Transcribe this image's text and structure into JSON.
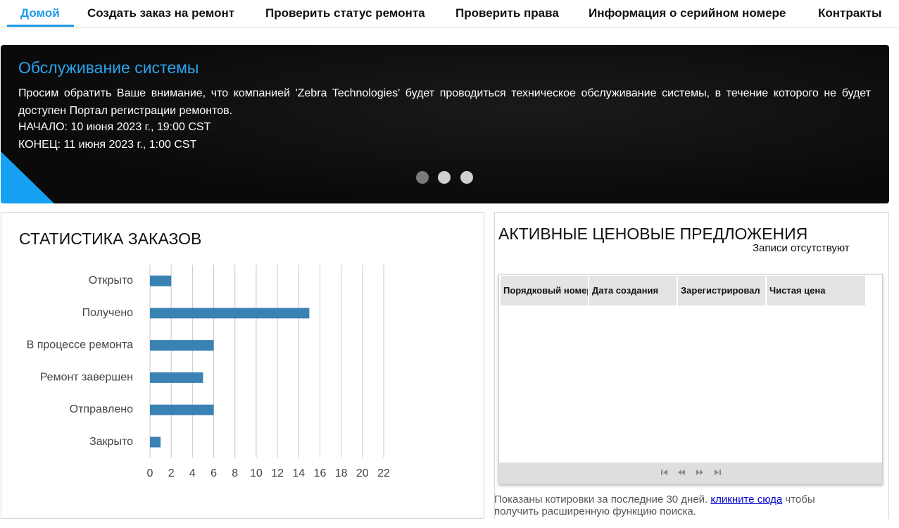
{
  "nav": {
    "tabs": [
      {
        "label": "Домой"
      },
      {
        "label": "Создать заказ на ремонт"
      },
      {
        "label": "Проверить статус ремонта"
      },
      {
        "label": "Проверить права"
      },
      {
        "label": "Информация о серийном номере"
      },
      {
        "label": "Контракты"
      }
    ],
    "active_color": "#1e9be9"
  },
  "banner": {
    "title": "Обслуживание системы",
    "text": "Просим обратить Ваше внимание, что компанией 'Zebra Technologies' будет проводиться техническое обслуживание системы, в течение которого не будет доступен Портал регистрации ремонтов.",
    "start": "НАЧАЛО: 10 июня 2023 г., 19:00 CST",
    "end": "КОНЕЦ: 11 июня 2023 г., 1:00 CST",
    "slides": 3,
    "active_slide": 1,
    "title_color": "#2ba3ee",
    "corner_color": "#16a1f2"
  },
  "stats": {
    "title": "СТАТИСТИКА ЗАКАЗОВ"
  },
  "chart_data": {
    "type": "bar",
    "orientation": "horizontal",
    "categories": [
      "Открыто",
      "Получено",
      "В процессе ремонта",
      "Ремонт завершен",
      "Отправлено",
      "Закрыто"
    ],
    "values": [
      2,
      15,
      6,
      5,
      6,
      1
    ],
    "xlim": [
      0,
      22
    ],
    "xticks": [
      0,
      2,
      4,
      6,
      8,
      10,
      12,
      14,
      16,
      18,
      20,
      22
    ],
    "grid": true,
    "bar_color": "#3a81b4"
  },
  "quotes": {
    "title": "АКТИВНЫЕ ЦЕНОВЫЕ ПРЕДЛОЖЕНИЯ",
    "empty_text": "Записи отсутствуют",
    "columns": [
      "Порядковый номер",
      "Дата создания",
      "Зарегистрировал",
      "Чистая цена"
    ],
    "rows": [],
    "footnote_before": "Показаны котировки за последние 30 дней. ",
    "footnote_link": "кликните сюда",
    "footnote_after": " чтобы получить расширенную функцию поиска."
  },
  "pager": {
    "icons": [
      "first-page-icon",
      "prev-page-icon",
      "next-page-icon",
      "last-page-icon"
    ]
  }
}
